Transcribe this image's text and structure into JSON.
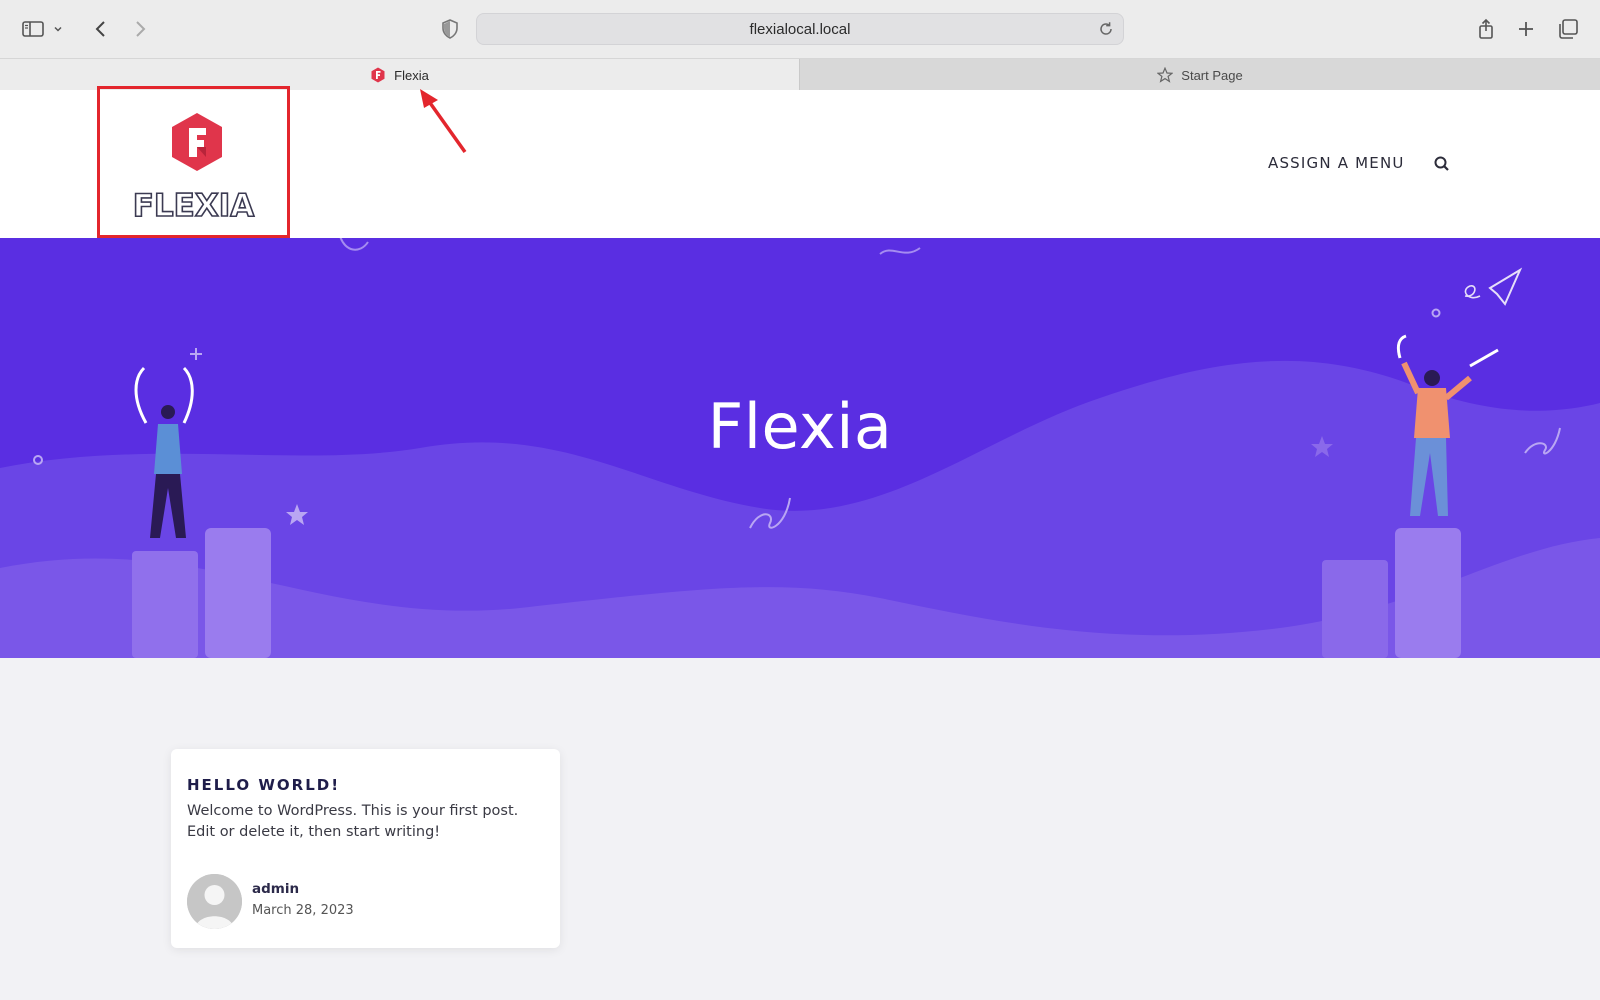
{
  "browser": {
    "url": "flexialocal.local",
    "tabs": [
      {
        "label": "Flexia",
        "active": true,
        "icon": "flexia-favicon"
      },
      {
        "label": "Start Page",
        "active": false,
        "icon": "star-icon"
      }
    ],
    "icons": [
      "sidebar-icon",
      "chevron-down-icon",
      "back-icon",
      "forward-icon",
      "shield-icon",
      "reload-icon",
      "share-icon",
      "new-tab-icon",
      "tab-overview-icon"
    ]
  },
  "site": {
    "logo_text": "FLEXIA",
    "nav_menu": "ASSIGN A MENU",
    "search_icon": "search-icon",
    "accent_color": "#e3262d"
  },
  "hero": {
    "title": "Flexia",
    "background_color": "#5a2ee2"
  },
  "posts": [
    {
      "title": "HELLO WORLD!",
      "excerpt": "Welcome to WordPress. This is your first post. Edit or delete it, then start writing!",
      "author": "admin",
      "date": "March 28, 2023"
    }
  ]
}
